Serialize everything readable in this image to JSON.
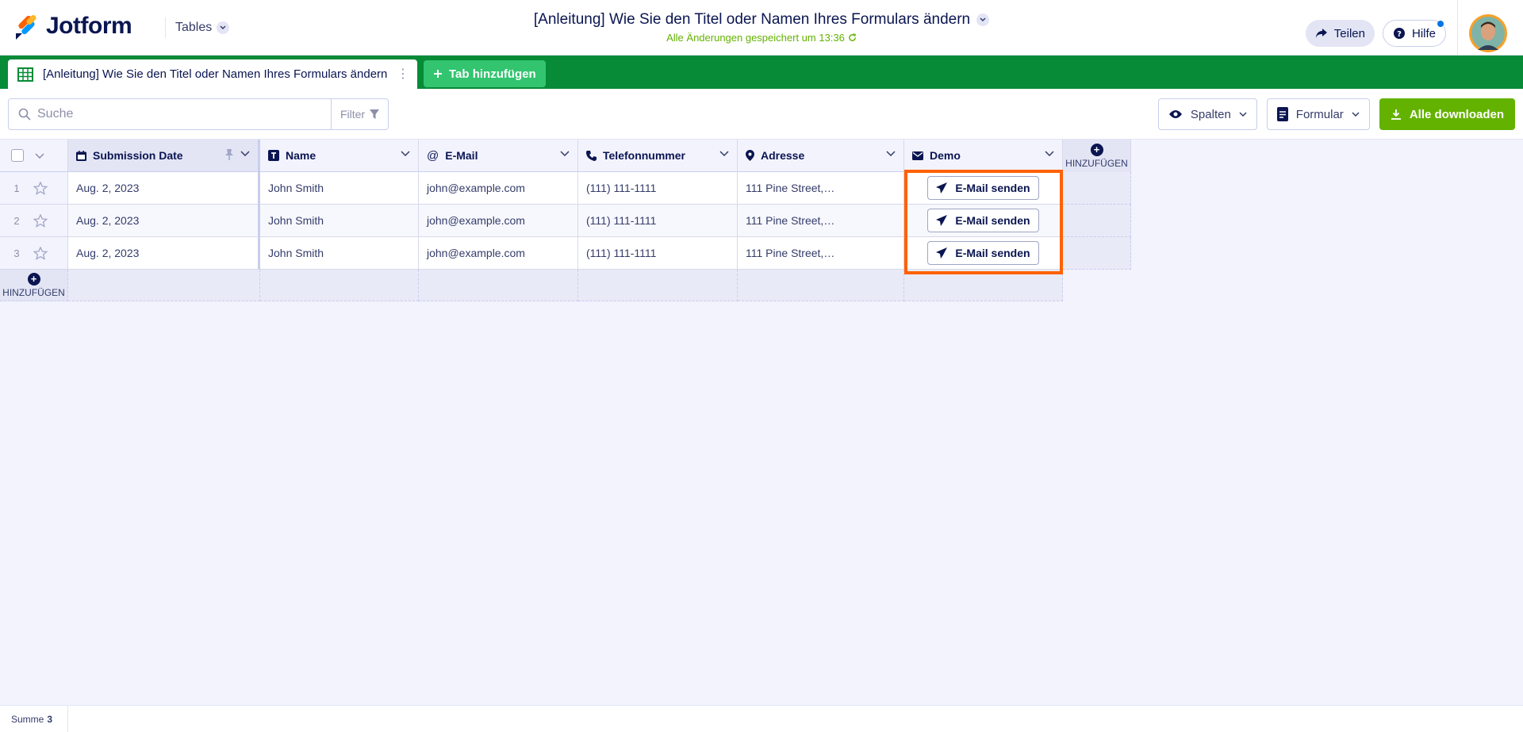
{
  "header": {
    "logo_text": "Jotform",
    "tables_label": "Tables",
    "title": "[Anleitung] Wie Sie den Titel oder Namen Ihres Formulars ändern",
    "saved_status": "Alle Änderungen gespeichert um 13:36",
    "share_label": "Teilen",
    "help_label": "Hilfe"
  },
  "tabs": {
    "active_label": "[Anleitung] Wie Sie den Titel oder Namen Ihres Formulars ändern",
    "add_label": "Tab hinzufügen"
  },
  "toolbar": {
    "search_placeholder": "Suche",
    "filter_label": "Filter",
    "columns_label": "Spalten",
    "form_label": "Formular",
    "download_label": "Alle downloaden"
  },
  "table": {
    "columns": [
      "Submission Date",
      "Name",
      "E-Mail",
      "Telefonnummer",
      "Adresse",
      "Demo"
    ],
    "add_column_label": "HINZUFÜGEN",
    "add_row_label": "HINZUFÜGEN",
    "rows": [
      {
        "num": "1",
        "date": "Aug. 2, 2023",
        "name": "John Smith",
        "email": "john@example.com",
        "phone": "(111) 111-1111",
        "address": "111 Pine Street,…",
        "action": "E-Mail senden"
      },
      {
        "num": "2",
        "date": "Aug. 2, 2023",
        "name": "John Smith",
        "email": "john@example.com",
        "phone": "(111) 111-1111",
        "address": "111 Pine Street,…",
        "action": "E-Mail senden"
      },
      {
        "num": "3",
        "date": "Aug. 2, 2023",
        "name": "John Smith",
        "email": "john@example.com",
        "phone": "(111) 111-1111",
        "address": "111 Pine Street,…",
        "action": "E-Mail senden"
      }
    ]
  },
  "footer": {
    "sum_label": "Summe",
    "sum_value": "3"
  },
  "colors": {
    "brand_navy": "#0a1551",
    "tab_green": "#078b37",
    "download_green": "#64b200",
    "highlight_orange": "#ff6100"
  }
}
